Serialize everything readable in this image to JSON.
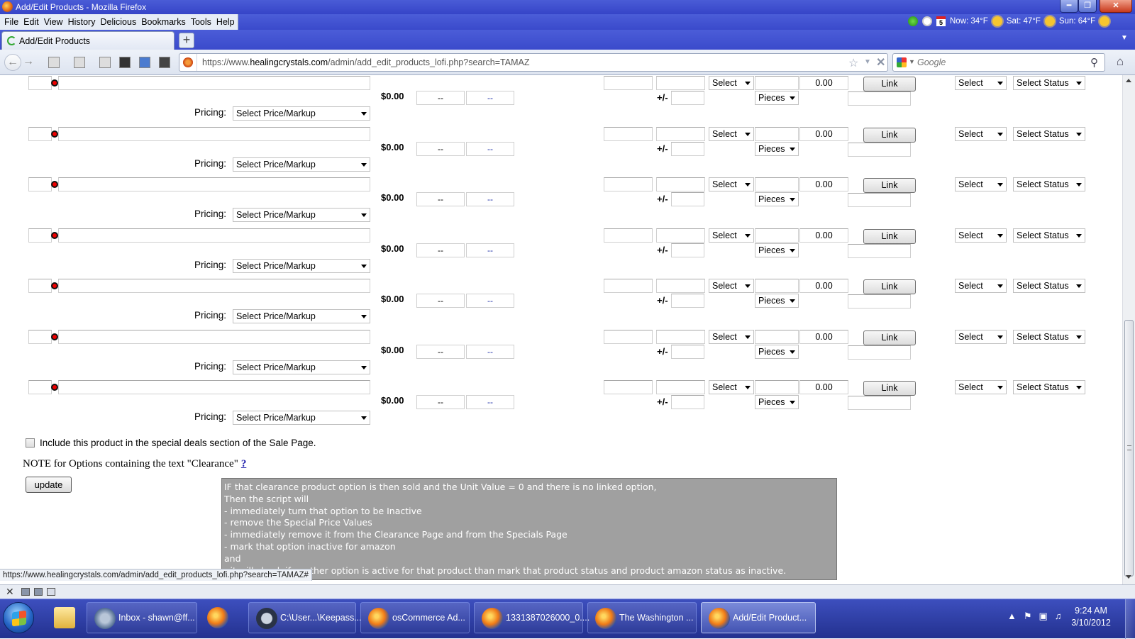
{
  "window": {
    "title": "Add/Edit Products - Mozilla Firefox"
  },
  "menu": [
    "File",
    "Edit",
    "View",
    "History",
    "Delicious",
    "Bookmarks",
    "Tools",
    "Help"
  ],
  "status_icons": {
    "calendar_day": "5",
    "weather_now": "Now: 34°F",
    "weather_sat": "Sat: 47°F",
    "weather_sun": "Sun: 64°F"
  },
  "tab": {
    "label": "Add/Edit Products",
    "new_tab_symbol": "+"
  },
  "navigation": {
    "url_prefix": "https://www.",
    "url_domain": "healingcrystals.com",
    "url_path": "/admin/add_edit_products_lofi.php?search=TAMAZ",
    "search_placeholder": "Google"
  },
  "rows": {
    "price": "$0.00",
    "dash": "--",
    "pricing_label": "Pricing:",
    "pricing_select": "Select Price/Markup",
    "pm_label": "+/-",
    "select_label": "Select",
    "unit_select": "Pieces",
    "unit_value": "0.00",
    "link_button": "Link",
    "status_select": "Select Status",
    "count": 7
  },
  "sale": {
    "checkbox_label": "Include this product in the special deals section of the Sale Page.",
    "checked": false
  },
  "note": {
    "text": "NOTE for Options containing the text \"Clearance\"",
    "help_link": "?"
  },
  "update_button": "update",
  "tooltip_lines": [
    "IF that clearance product option is then sold and the Unit Value = 0 and there is no linked option,",
    "Then the script will",
    "- immediately turn that option to be Inactive",
    "- remove the Special Price Values",
    "- immediately remove it from the Clearance Page and from the Specials Page",
    "- mark that option inactive for amazon",
    "and",
    "- it will check if another option is active for that product than mark that product status and product amazon status as inactive."
  ],
  "status_bar_url": "https://www.healingcrystals.com/admin/add_edit_products_lofi.php?search=TAMAZ#",
  "taskbar": {
    "items": [
      {
        "label": "Inbox - shawn@ff...",
        "icon": "thunderbird-icon"
      },
      {
        "label": "",
        "icon": "firefox-icon"
      },
      {
        "label": "C:\\User...\\Keepass...",
        "icon": "keepass-icon"
      },
      {
        "label": "osCommerce Ad...",
        "icon": "firefox-icon"
      },
      {
        "label": "1331387026000_0....",
        "icon": "firefox-icon"
      },
      {
        "label": "The Washington ...",
        "icon": "firefox-icon"
      },
      {
        "label": "Add/Edit Product...",
        "icon": "firefox-icon"
      }
    ],
    "clock_time": "9:24 AM",
    "clock_date": "3/10/2012"
  }
}
